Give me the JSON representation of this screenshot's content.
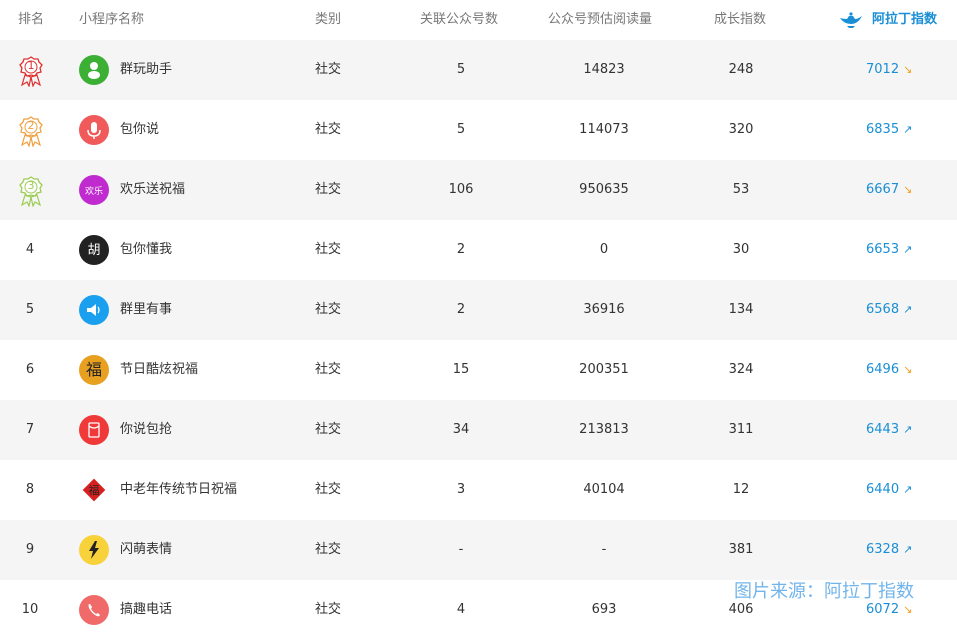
{
  "header": {
    "rank": "排名",
    "name": "小程序名称",
    "category": "类别",
    "public_accounts": "关联公众号数",
    "read_estimate": "公众号预估阅读量",
    "growth": "成长指数",
    "ala_index": "阿拉丁指数"
  },
  "colors": {
    "accent": "#1a8fd6",
    "up": "#1a8fd6",
    "down": "#f0a020"
  },
  "rows": [
    {
      "rank": "1",
      "name": "群玩助手",
      "category": "社交",
      "public_accounts": "5",
      "read_estimate": "14823",
      "growth": "248",
      "index": "7012",
      "trend": "down",
      "icon": "people-icon",
      "icon_bg": "#3cb035",
      "icon_text": ""
    },
    {
      "rank": "2",
      "name": "包你说",
      "category": "社交",
      "public_accounts": "5",
      "read_estimate": "114073",
      "growth": "320",
      "index": "6835",
      "trend": "up",
      "icon": "microphone-icon",
      "icon_bg": "#f05a5a",
      "icon_text": ""
    },
    {
      "rank": "3",
      "name": "欢乐送祝福",
      "category": "社交",
      "public_accounts": "106",
      "read_estimate": "950635",
      "growth": "53",
      "index": "6667",
      "trend": "down",
      "icon": "greeting-logo-icon",
      "icon_bg": "#c02bd0",
      "icon_text": "欢乐"
    },
    {
      "rank": "4",
      "name": "包你懂我",
      "category": "社交",
      "public_accounts": "2",
      "read_estimate": "0",
      "growth": "30",
      "index": "6653",
      "trend": "up",
      "icon": "calligraphy-logo-icon",
      "icon_bg": "#222222",
      "icon_text": "胡"
    },
    {
      "rank": "5",
      "name": "群里有事",
      "category": "社交",
      "public_accounts": "2",
      "read_estimate": "36916",
      "growth": "134",
      "index": "6568",
      "trend": "up",
      "icon": "megaphone-icon",
      "icon_bg": "#1aa0ee",
      "icon_text": ""
    },
    {
      "rank": "6",
      "name": "节日酷炫祝福",
      "category": "社交",
      "public_accounts": "15",
      "read_estimate": "200351",
      "growth": "324",
      "index": "6496",
      "trend": "down",
      "icon": "fu-character-icon",
      "icon_bg": "#e8a020",
      "icon_text": "福"
    },
    {
      "rank": "7",
      "name": "你说包抢",
      "category": "社交",
      "public_accounts": "34",
      "read_estimate": "213813",
      "growth": "311",
      "index": "6443",
      "trend": "up",
      "icon": "red-envelope-icon",
      "icon_bg": "#f03a3a",
      "icon_text": ""
    },
    {
      "rank": "8",
      "name": "中老年传统节日祝福",
      "category": "社交",
      "public_accounts": "3",
      "read_estimate": "40104",
      "growth": "12",
      "index": "6440",
      "trend": "up",
      "icon": "fu-diamond-icon",
      "icon_bg": "#d82020",
      "icon_text": "福"
    },
    {
      "rank": "9",
      "name": "闪萌表情",
      "category": "社交",
      "public_accounts": "-",
      "read_estimate": "-",
      "growth": "381",
      "index": "6328",
      "trend": "up",
      "icon": "lightning-icon",
      "icon_bg": "#f8d23a",
      "icon_text": ""
    },
    {
      "rank": "10",
      "name": "搞趣电话",
      "category": "社交",
      "public_accounts": "4",
      "read_estimate": "693",
      "growth": "406",
      "index": "6072",
      "trend": "down",
      "icon": "phone-icon",
      "icon_bg": "#f06a6a",
      "icon_text": ""
    }
  ],
  "watermark": "图片来源：阿拉丁指数"
}
